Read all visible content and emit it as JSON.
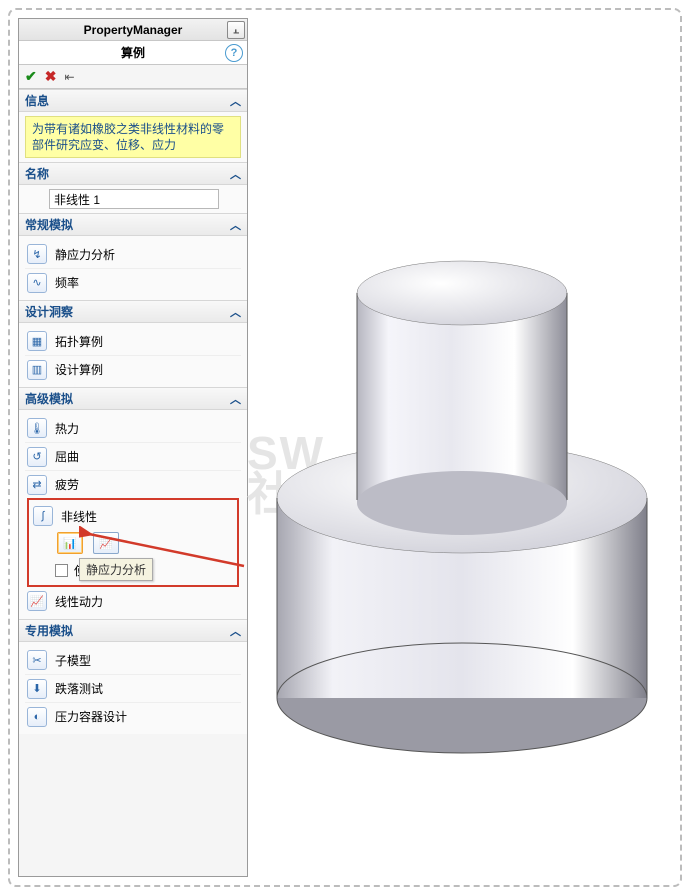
{
  "header": {
    "title": "PropertyManager"
  },
  "subtitle": "算例",
  "info": {
    "label": "信息",
    "text": "为带有诸如橡胶之类非线性材料的零部件研究应变、位移、应力"
  },
  "name": {
    "label": "名称",
    "value": "非线性 1"
  },
  "groups": {
    "general": {
      "label": "常规模拟",
      "items": [
        {
          "label": "静应力分析",
          "icon": "↯"
        },
        {
          "label": "频率",
          "icon": "∿"
        }
      ]
    },
    "insight": {
      "label": "设计洞察",
      "items": [
        {
          "label": "拓扑算例",
          "icon": "▦"
        },
        {
          "label": "设计算例",
          "icon": "▥"
        }
      ]
    },
    "advanced": {
      "label": "高级模拟",
      "items": [
        {
          "label": "热力",
          "icon": "🌡"
        },
        {
          "label": "屈曲",
          "icon": "↺"
        },
        {
          "label": "疲劳",
          "icon": "⇄"
        }
      ],
      "nonlinear": {
        "label": "非线性",
        "icon": "∫",
        "tooltip": "静应力分析",
        "checkbox_label": "使用"
      },
      "linear_dynamic": {
        "label": "线性动力",
        "icon": "📈"
      }
    },
    "special": {
      "label": "专用模拟",
      "items": [
        {
          "label": "子模型",
          "icon": "✂"
        },
        {
          "label": "跌落测试",
          "icon": "⬇"
        },
        {
          "label": "压力容器设计",
          "icon": "◐"
        }
      ]
    }
  },
  "watermark": "SW\n社"
}
